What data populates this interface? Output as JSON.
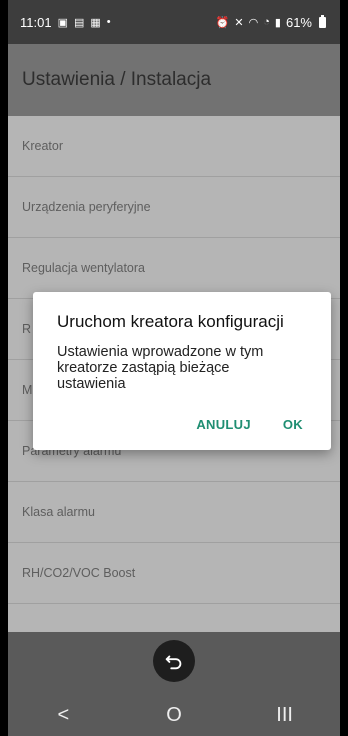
{
  "status_bar": {
    "time": "11:01",
    "left_icons": [
      "gallery-icon",
      "app-icon",
      "mail-icon",
      "dot-icon"
    ],
    "right_icons": [
      "alarm-icon",
      "mute-icon",
      "wifi-icon",
      "call-icon",
      "signal-icon"
    ],
    "battery_percent": "61%"
  },
  "app_bar": {
    "title": "Ustawienia / Instalacja"
  },
  "list": {
    "items": [
      "Kreator",
      "Urządzenia peryferyjne",
      "Regulacja wentylatora",
      "R",
      "M",
      "Parametry alarmu",
      "Klasa alarmu",
      "RH/CO2/VOC Boost",
      ""
    ]
  },
  "dialog": {
    "title": "Uruchom kreatora konfiguracji",
    "message": "Ustawienia wprowadzone w tym kreatorze zastąpią bieżące ustawienia",
    "cancel_label": "ANULUJ",
    "ok_label": "OK"
  },
  "nav": {
    "back_glyph": "<",
    "home_glyph": "O",
    "recents_glyph": "III"
  }
}
